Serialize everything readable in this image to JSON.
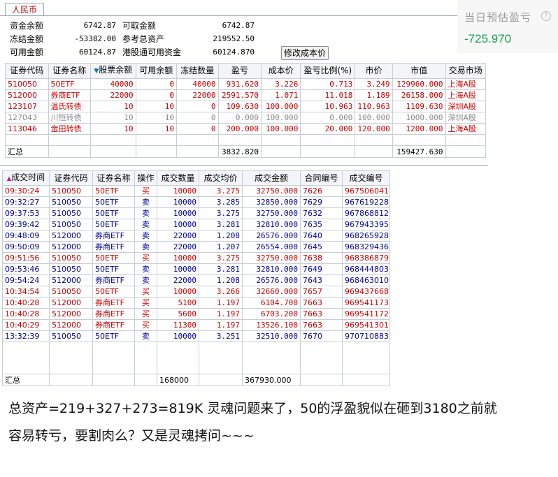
{
  "account": {
    "tab": "人民币",
    "rows": [
      {
        "l1": "资金余额",
        "v1": "6742.87",
        "l2": "可取金额",
        "v2": "6742.87"
      },
      {
        "l1": "冻结金额",
        "v1": "-53382.00",
        "l2": "参考总资产",
        "v2": "219552.50"
      },
      {
        "l1": "可用金额",
        "v1": "60124.87",
        "l2": "港股通可用资金",
        "v2": "60124.870"
      }
    ],
    "button": "修改成本价"
  },
  "estimate": {
    "label": "当日预估盈亏",
    "help": "?",
    "value": "-725.970"
  },
  "positions": {
    "headers": [
      "证券代码",
      "证券名称",
      "股票余额",
      "可用余额",
      "冻结数量",
      "盈亏",
      "成本价",
      "盈亏比例(%)",
      "市价",
      "市值",
      "交易市场"
    ],
    "rows": [
      {
        "c": [
          "510050",
          "50ETF",
          "40000",
          "0",
          "40000",
          "931.620",
          "3.226",
          "0.713",
          "3.249",
          "129960.000",
          "上海A股"
        ],
        "color": "red"
      },
      {
        "c": [
          "512000",
          "券商ETF",
          "22000",
          "0",
          "22000",
          "2591.570",
          "1.071",
          "11.018",
          "1.189",
          "26158.000",
          "上海A股"
        ],
        "color": "red"
      },
      {
        "c": [
          "123107",
          "温氏转债",
          "10",
          "10",
          "0",
          "109.630",
          "100.000",
          "10.963",
          "110.963",
          "1109.630",
          "深圳A股"
        ],
        "color": "red"
      },
      {
        "c": [
          "127043",
          "川恒转债",
          "10",
          "10",
          "0",
          "0.000",
          "100.000",
          "0.000",
          "100.000",
          "1000.000",
          "深圳A股"
        ],
        "color": "gray"
      },
      {
        "c": [
          "113046",
          "金田转债",
          "10",
          "10",
          "0",
          "200.000",
          "100.000",
          "20.000",
          "120.000",
          "1200.000",
          "上海A股"
        ],
        "color": "red"
      }
    ],
    "summary": {
      "label": "汇总",
      "pnl": "3832.820",
      "value": "159427.630"
    }
  },
  "trades": {
    "headers": [
      "成交时间",
      "证券代码",
      "证券名称",
      "操作",
      "成交数量",
      "成交均价",
      "成交金额",
      "合同编号",
      "成交编号"
    ],
    "rows": [
      {
        "c": [
          "09:30:24",
          "510050",
          "50ETF",
          "买",
          "10000",
          "3.275",
          "32750.000",
          "7626",
          "967506041"
        ],
        "color": "red"
      },
      {
        "c": [
          "09:32:27",
          "510050",
          "50ETF",
          "卖",
          "10000",
          "3.285",
          "32850.000",
          "7629",
          "967619228"
        ],
        "color": "navy"
      },
      {
        "c": [
          "09:37:53",
          "510050",
          "50ETF",
          "卖",
          "10000",
          "3.275",
          "32750.000",
          "7632",
          "967868812"
        ],
        "color": "navy"
      },
      {
        "c": [
          "09:39:42",
          "510050",
          "50ETF",
          "卖",
          "10000",
          "3.281",
          "32810.000",
          "7635",
          "967943395"
        ],
        "color": "navy"
      },
      {
        "c": [
          "09:48:09",
          "512000",
          "券商ETF",
          "卖",
          "22000",
          "1.208",
          "26576.000",
          "7640",
          "968265928"
        ],
        "color": "navy"
      },
      {
        "c": [
          "09:50:09",
          "512000",
          "券商ETF",
          "卖",
          "22000",
          "1.207",
          "26554.000",
          "7645",
          "968329436"
        ],
        "color": "navy"
      },
      {
        "c": [
          "09:51:56",
          "510050",
          "50ETF",
          "买",
          "10000",
          "3.275",
          "32750.000",
          "7638",
          "968386879"
        ],
        "color": "red"
      },
      {
        "c": [
          "09:53:46",
          "510050",
          "50ETF",
          "卖",
          "10000",
          "3.281",
          "32810.000",
          "7649",
          "968444803"
        ],
        "color": "navy"
      },
      {
        "c": [
          "09:54:24",
          "512000",
          "券商ETF",
          "卖",
          "22000",
          "1.208",
          "26576.000",
          "7643",
          "968463010"
        ],
        "color": "navy"
      },
      {
        "c": [
          "10:34:54",
          "510050",
          "50ETF",
          "买",
          "10000",
          "3.266",
          "32660.000",
          "7657",
          "969437668"
        ],
        "color": "red"
      },
      {
        "c": [
          "10:40:28",
          "512000",
          "券商ETF",
          "买",
          "5100",
          "1.197",
          "6104.700",
          "7663",
          "969541173"
        ],
        "color": "red"
      },
      {
        "c": [
          "10:40:28",
          "512000",
          "券商ETF",
          "买",
          "5600",
          "1.197",
          "6703.200",
          "7663",
          "969541172"
        ],
        "color": "red"
      },
      {
        "c": [
          "10:40:29",
          "512000",
          "券商ETF",
          "买",
          "11300",
          "1.197",
          "13526.100",
          "7663",
          "969541301"
        ],
        "color": "red"
      },
      {
        "c": [
          "13:32:39",
          "510050",
          "50ETF",
          "卖",
          "10000",
          "3.251",
          "32510.000",
          "7670",
          "970710883"
        ],
        "color": "navy"
      }
    ],
    "summary": {
      "label": "汇总",
      "qty": "168000",
      "amount": "367930.000"
    }
  },
  "caption": {
    "line1": "总资产=219+327+273=819K 灵魂问题来了，50的浮盈貌似在砸到3180之前就",
    "line2": "容易转亏，要割肉么？又是灵魂拷问~~~"
  }
}
